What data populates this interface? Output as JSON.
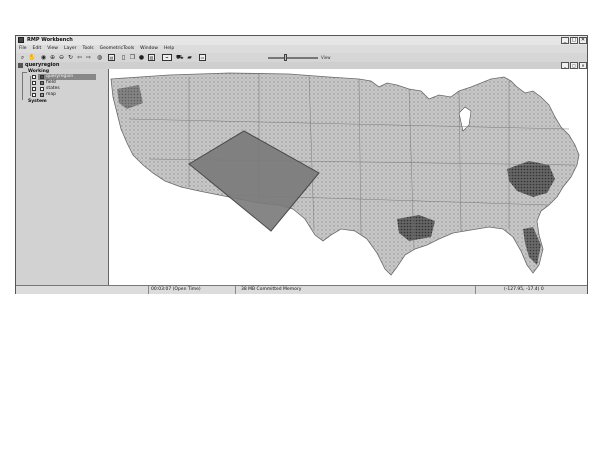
{
  "window": {
    "title": "RMP Workbench",
    "controls": [
      "_",
      "▢",
      "✕"
    ]
  },
  "menubar": {
    "items": [
      "File",
      "Edit",
      "View",
      "Layer",
      "Tools",
      "GeometricTools",
      "Window",
      "Help"
    ]
  },
  "toolbar": {
    "zoom_label": "View"
  },
  "document": {
    "title": "queryregion",
    "controls": [
      "_",
      "▢",
      "✕"
    ]
  },
  "tree": {
    "working_label": "Working",
    "layers": [
      {
        "label": "queryregion",
        "selected": true,
        "swatch": "#555555"
      },
      {
        "label": "field",
        "selected": false,
        "swatch": "#777777"
      },
      {
        "label": "states",
        "selected": false,
        "swatch": "#ffffff"
      },
      {
        "label": "map",
        "selected": false,
        "swatch": "#999999"
      }
    ],
    "system_label": "System"
  },
  "map": {
    "query_region_color": "#7a7a7a",
    "land_color": "#bdbdbd",
    "dense_color": "#3a3a3a"
  },
  "statusbar": {
    "time": "00:03:07 (Open Time)",
    "memory": "38 MB Committed Memory",
    "coords": "(-127.95, -17.4) 0"
  }
}
